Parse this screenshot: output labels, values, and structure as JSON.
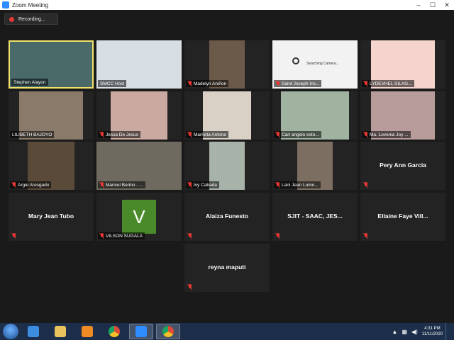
{
  "window": {
    "title": "Zoom Meeting",
    "minimize": "–",
    "maximize": "☐",
    "close": "✕"
  },
  "recording": {
    "label": "Recording..."
  },
  "participants": [
    {
      "name": "Stephen Alayon",
      "video": true,
      "active": true,
      "muted": false
    },
    {
      "name": "SMCC Host",
      "video": true,
      "muted": false
    },
    {
      "name": "Madelyn Aniñon",
      "video": true,
      "muted": true
    },
    {
      "name": "Saint Joseph Ins...",
      "video": true,
      "muted": true,
      "screen_text": "Searching Camera..."
    },
    {
      "name": "LYDEVHEL SILAG...",
      "video": true,
      "muted": true
    },
    {
      "name": "LILIBETH BAJOYO",
      "video": true,
      "muted": false
    },
    {
      "name": "Jessa De Jesus",
      "video": true,
      "muted": true
    },
    {
      "name": "Marrieta Antone",
      "video": true,
      "muted": true
    },
    {
      "name": "Carl angelo esto...",
      "video": true,
      "muted": true
    },
    {
      "name": "Ma. Lovenia Joy ...",
      "video": true,
      "muted": true
    },
    {
      "name": "Argie Aresgado",
      "video": true,
      "muted": true
    },
    {
      "name": "Maricel Berino - ...",
      "video": true,
      "muted": true
    },
    {
      "name": "Ivy Cabada",
      "video": true,
      "muted": true
    },
    {
      "name": "Lani  Jean Lumo...",
      "video": true,
      "muted": true
    },
    {
      "name": "Pery Ann Garcia",
      "video": false,
      "muted": true
    },
    {
      "name": "Mary Jean Tubo",
      "video": false,
      "muted": true
    },
    {
      "name": "VILSON SUGALA",
      "video": false,
      "muted": true,
      "avatar_letter": "V"
    },
    {
      "name": "Alaiza Funesto",
      "video": false,
      "muted": true
    },
    {
      "name": "SJIT - SAAC, JES...",
      "video": false,
      "muted": true
    },
    {
      "name": "Ellaine  Faye Vill...",
      "video": false,
      "muted": true
    },
    {
      "name": "reyna maputi",
      "video": false,
      "muted": true
    }
  ],
  "taskbar": {
    "apps": [
      {
        "icon": "internet-explorer-icon",
        "color": "#3c8de0"
      },
      {
        "icon": "file-explorer-icon",
        "color": "#e8c25a"
      },
      {
        "icon": "media-player-icon",
        "color": "#f08a24"
      },
      {
        "icon": "chrome-icon",
        "color": "#dd4b39"
      },
      {
        "icon": "zoom-icon",
        "color": "#2d8cff"
      },
      {
        "icon": "chrome-icon",
        "color": "#dd4b39"
      }
    ],
    "time": "4:31 PM",
    "date": "11/11/2020"
  }
}
